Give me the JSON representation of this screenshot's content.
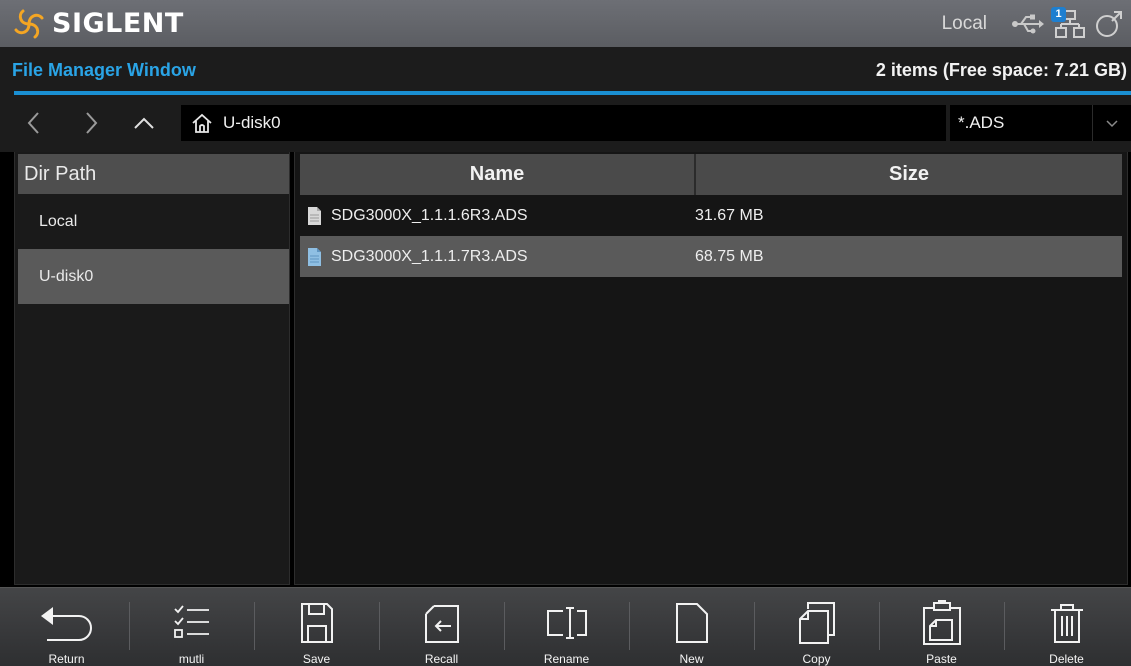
{
  "brand": {
    "name": "SIGLENT",
    "logo": "siglent-swirl-logo"
  },
  "status": {
    "mode": "Local",
    "usb_icon": "usb-icon",
    "network_icon": "network-icon",
    "network_badge": "1",
    "external_icon": "external-link-icon"
  },
  "window": {
    "title": "File Manager Window",
    "summary": "2 items (Free space: 7.21 GB)"
  },
  "nav": {
    "back_icon": "chevron-left-icon",
    "forward_icon": "chevron-right-icon",
    "up_icon": "chevron-up-icon",
    "home_icon": "home-icon",
    "path": "U-disk0",
    "filter": "*.ADS",
    "filter_icon": "chevron-down-icon"
  },
  "dir_panel": {
    "header": "Dir Path",
    "items": [
      {
        "label": "Local",
        "active": false
      },
      {
        "label": "U-disk0",
        "active": true
      }
    ]
  },
  "file_table": {
    "columns": [
      "Name",
      "Size"
    ],
    "rows": [
      {
        "name": "SDG3000X_1.1.1.6R3.ADS",
        "size": "31.67 MB",
        "selected": false
      },
      {
        "name": "SDG3000X_1.1.1.7R3.ADS",
        "size": "68.75 MB",
        "selected": true
      }
    ]
  },
  "toolbar": {
    "items": [
      {
        "label": "Return",
        "icon": "return-icon"
      },
      {
        "label": "mutli",
        "icon": "checklist-icon"
      },
      {
        "label": "Save",
        "icon": "save-icon"
      },
      {
        "label": "Recall",
        "icon": "recall-icon"
      },
      {
        "label": "Rename",
        "icon": "rename-icon"
      },
      {
        "label": "New",
        "icon": "new-file-icon"
      },
      {
        "label": "Copy",
        "icon": "copy-icon"
      },
      {
        "label": "Paste",
        "icon": "paste-icon"
      },
      {
        "label": "Delete",
        "icon": "trash-icon"
      }
    ]
  },
  "colors": {
    "accent": "#1a8fd2",
    "title_text": "#2aa4e6",
    "logo_orange": "#f5a623",
    "selected_row": "#5a5a5a"
  }
}
